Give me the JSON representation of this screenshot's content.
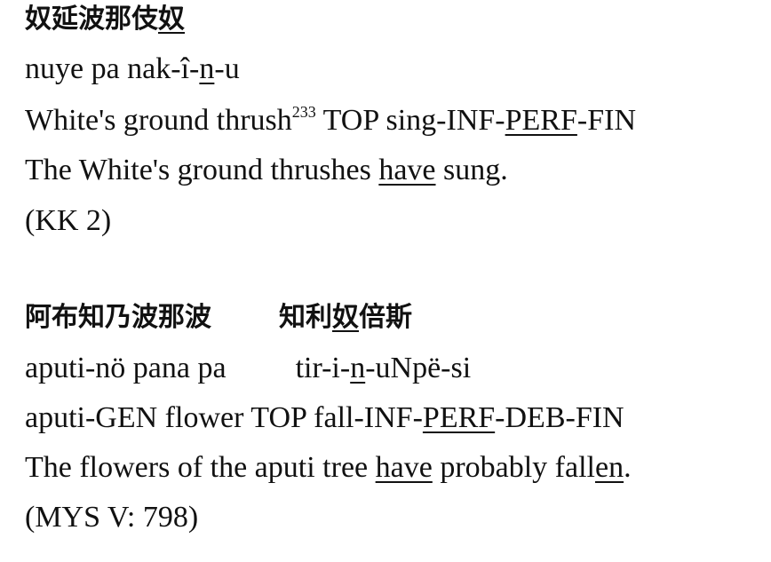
{
  "ex1": {
    "script_pre": "奴延波那伎",
    "script_ul": "奴",
    "translit_pre": "nuye pa nak-î-",
    "translit_ul": "n",
    "translit_post": "-u",
    "gloss_pre": "White's ground thrush",
    "gloss_sup": "233",
    "gloss_mid": " TOP sing-INF-",
    "gloss_ul": "PERF",
    "gloss_post": "-FIN",
    "trans_pre": "The White's ground thrushes ",
    "trans_ul": "have",
    "trans_post": " sung.",
    "source": "(KK 2)"
  },
  "ex2": {
    "script_a": "阿布知乃波那波",
    "script_b_pre": "知利",
    "script_b_ul": "奴",
    "script_b_post": "倍斯",
    "translit_a": "aputi-nö pana pa",
    "translit_b_pre": "tir-i-",
    "translit_b_ul": "n",
    "translit_b_post": "-uNpë-si",
    "gloss_pre": "aputi-GEN flower TOP fall-INF-",
    "gloss_ul": "PERF",
    "gloss_post": "-DEB-FIN",
    "trans_pre": "The flowers of the aputi tree ",
    "trans_ul1": "have",
    "trans_mid": " probably fall",
    "trans_ul2": "en",
    "trans_post": ".",
    "source": "(MYS V: 798)"
  }
}
